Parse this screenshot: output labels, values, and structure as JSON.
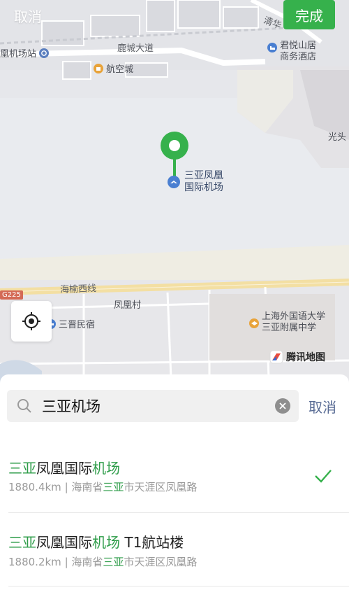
{
  "nav": {
    "cancel_label": "取消",
    "done_label": "完成"
  },
  "map": {
    "labels": {
      "qinghua": "清华",
      "airport_station": "凰机场站",
      "lucheng_road": "鹿城大道",
      "hangkong_city": "航空城",
      "junyue_line1": "君悦山居",
      "junyue_line2": "商务酒店",
      "guangtou": "光头",
      "airport_line1": "三亚凤凰",
      "airport_line2": "国际机场",
      "haiyu_west": "海榆西线",
      "g225": "G225",
      "fenghuang_village": "凤凰村",
      "sanjin_homestay": "三晋民宿",
      "sisu_line1": "上海外国语大学",
      "sisu_line2": "三亚附属中学",
      "tencent_map": "腾讯地图"
    },
    "colors": {
      "pin": "#36b14c",
      "poi_orange": "#e8a33a",
      "poi_blue": "#4a7fd1",
      "road_yellow": "#f3dfa3"
    }
  },
  "search": {
    "value": "三亚机场",
    "cancel_label": "取消"
  },
  "results": [
    {
      "title_a": "三亚",
      "title_b": "凤凰国际",
      "title_c": "机场",
      "title_d": "",
      "distance": "1880.4km",
      "sep": " | ",
      "addr_a": "海南省",
      "addr_b": "三亚",
      "addr_c": "市天涯区凤凰路",
      "selected": true
    },
    {
      "title_a": "三亚",
      "title_b": "凤凰国际",
      "title_c": "机场",
      "title_d": " T1航站楼",
      "distance": "1880.2km",
      "sep": " | ",
      "addr_a": "海南省",
      "addr_b": "三亚",
      "addr_c": "市天涯区凤凰路",
      "selected": false
    }
  ]
}
